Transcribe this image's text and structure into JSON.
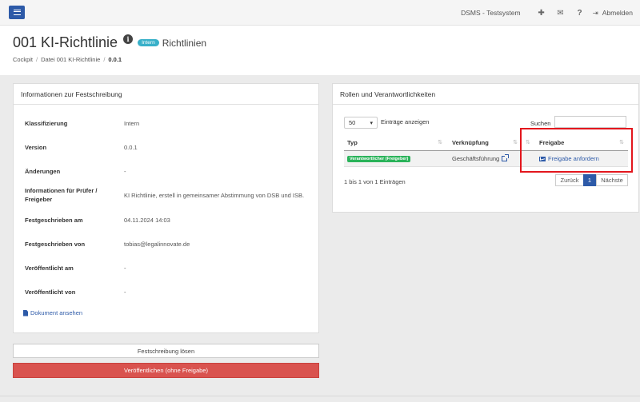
{
  "topbar": {
    "system_name": "DSMS - Testsystem",
    "logout_label": "Abmelden"
  },
  "header": {
    "title": "001 KI-Richtlinie",
    "badge": "Intern",
    "category": "Richtlinien",
    "breadcrumb": [
      "Cockpit",
      "Datei 001 KI-Richtlinie",
      "0.0.1"
    ]
  },
  "info_panel": {
    "title": "Informationen zur Festschreibung",
    "rows": [
      {
        "label": "Klassifizierung",
        "value": "Intern"
      },
      {
        "label": "Version",
        "value": "0.0.1"
      },
      {
        "label": "Änderungen",
        "value": "-"
      },
      {
        "label": "Informationen für Prüfer / Freigeber",
        "value": "KI Richtlinie, erstell in gemeinsamer Abstimmung von DSB und ISB."
      },
      {
        "label": "Festgeschrieben am",
        "value": "04.11.2024 14:03"
      },
      {
        "label": "Festgeschrieben von",
        "value": "tobias@legalinnovate.de"
      },
      {
        "label": "Veröffentlicht am",
        "value": "-"
      },
      {
        "label": "Veröffentlicht von",
        "value": "-"
      }
    ],
    "document_link": "Dokument ansehen"
  },
  "actions": {
    "release_label": "Festschreibung lösen",
    "publish_label": "Veröffentlichen (ohne Freigabe)"
  },
  "roles_panel": {
    "title": "Rollen und Verantwortlichkeiten",
    "page_length": "50",
    "page_length_label": "Einträge anzeigen",
    "search_label": "Suchen",
    "columns": [
      "Typ",
      "Verknüpfung",
      "Freigabe"
    ],
    "row": {
      "type": "Verantwortlicher (Freigeber)",
      "link": "Geschäftsführung",
      "approval": "Freigabe anfordern"
    },
    "info": "1 bis 1 von 1 Einträgen",
    "pager": {
      "prev": "Zurück",
      "current": "1",
      "next": "Nächste"
    }
  }
}
